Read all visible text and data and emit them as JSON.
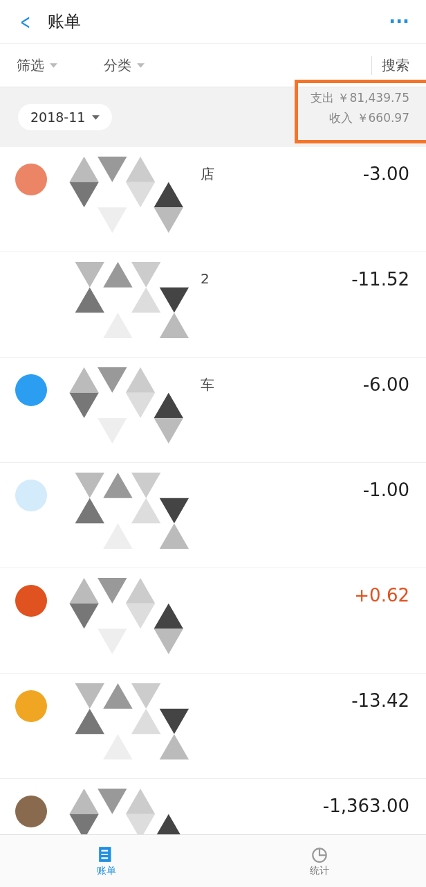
{
  "header": {
    "back": "<",
    "title": "账单",
    "more": "···"
  },
  "filters": [
    {
      "label": "筛选"
    },
    {
      "label": "分类"
    }
  ],
  "search": "搜索",
  "month": "2018-11",
  "summary": {
    "highlighted": true,
    "lines": [
      {
        "label": "支出",
        "value": "￥81,439.75"
      },
      {
        "label": "收入",
        "value": "￥660.97"
      }
    ]
  },
  "rows": [
    {
      "color": "#ec8466",
      "fragment": "店",
      "amount": "-3.00",
      "kind": "expense"
    },
    {
      "fragment": "2",
      "amount": "-11.52",
      "kind": "expense"
    },
    {
      "color": "#2b9ef2",
      "fragment": "车",
      "amount": "-6.00",
      "kind": "expense"
    },
    {
      "color": "#d3ebfa",
      "amount": "-1.00",
      "kind": "expense"
    },
    {
      "color": "#e0521f",
      "amount": "+0.62",
      "kind": "income"
    },
    {
      "color": "#f1a623",
      "amount": "-13.42",
      "kind": "expense"
    },
    {
      "color": "#8a6a4e",
      "amount": "-1,363.00",
      "kind": "expense"
    }
  ],
  "tabs": [
    {
      "label": "账单",
      "selected": true
    },
    {
      "label": "统计",
      "selected": false
    }
  ]
}
